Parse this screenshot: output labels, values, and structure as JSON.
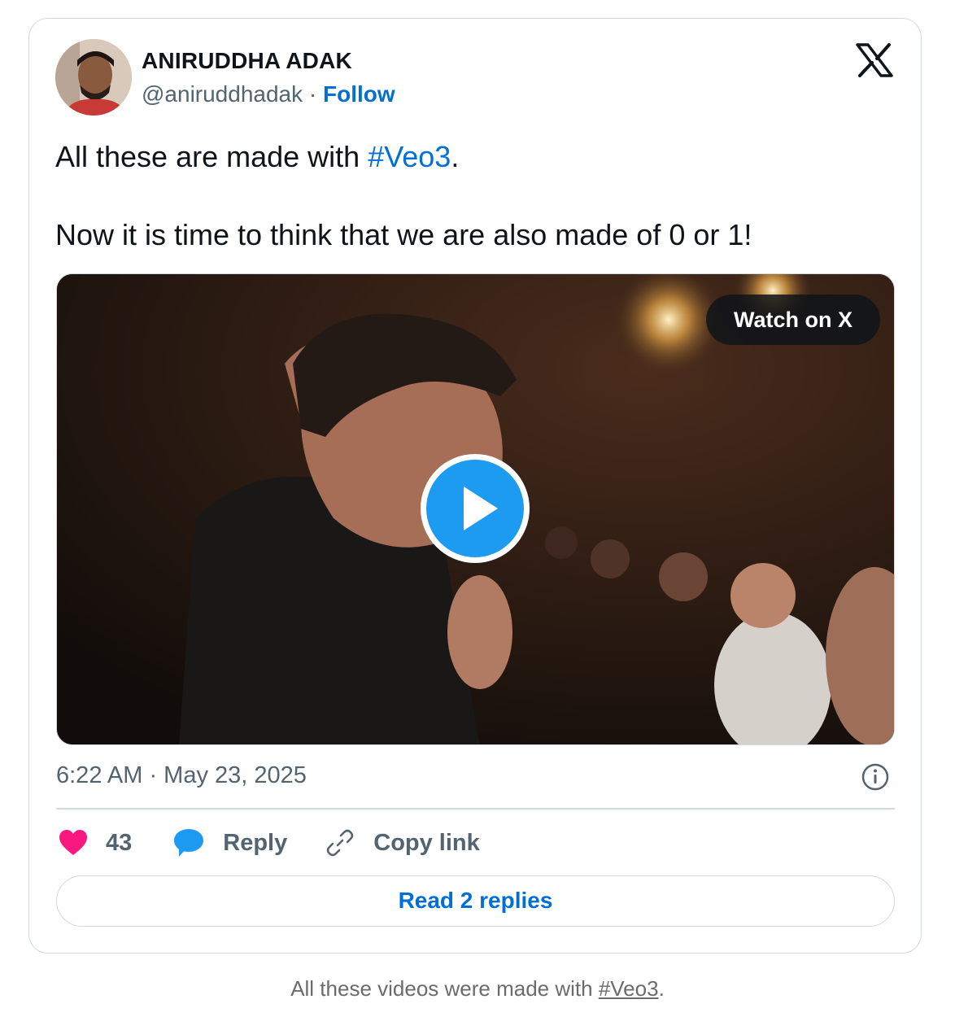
{
  "author": {
    "name": "ANIRUDDHA ADAK",
    "handle": "@aniruddhadak",
    "separator": "·",
    "follow_label": "Follow"
  },
  "tweet": {
    "line1_before": "All these are made with ",
    "line1_hashtag": "#Veo3",
    "line1_after": ".",
    "line2": "Now it is time to think that we are also made of 0 or 1!"
  },
  "media": {
    "watch_label": "Watch on X",
    "play_icon": "play-icon"
  },
  "timestamp": "6:22 AM · May 23, 2025",
  "actions": {
    "like_count": "43",
    "reply_label": "Reply",
    "copy_label": "Copy link"
  },
  "read_replies_label": "Read 2 replies",
  "caption": {
    "before": "All these videos were made with ",
    "hashtag": "#Veo3",
    "after": "."
  },
  "icons": {
    "brand": "x-logo-icon",
    "info": "info-icon",
    "like": "heart-icon",
    "reply": "reply-bubble-icon",
    "copy": "link-icon"
  },
  "colors": {
    "link": "#006fd6",
    "play": "#1d9bf0",
    "heart": "#f91880",
    "reply": "#1d9bf0",
    "border": "#cfd9de",
    "muted": "#536471"
  }
}
